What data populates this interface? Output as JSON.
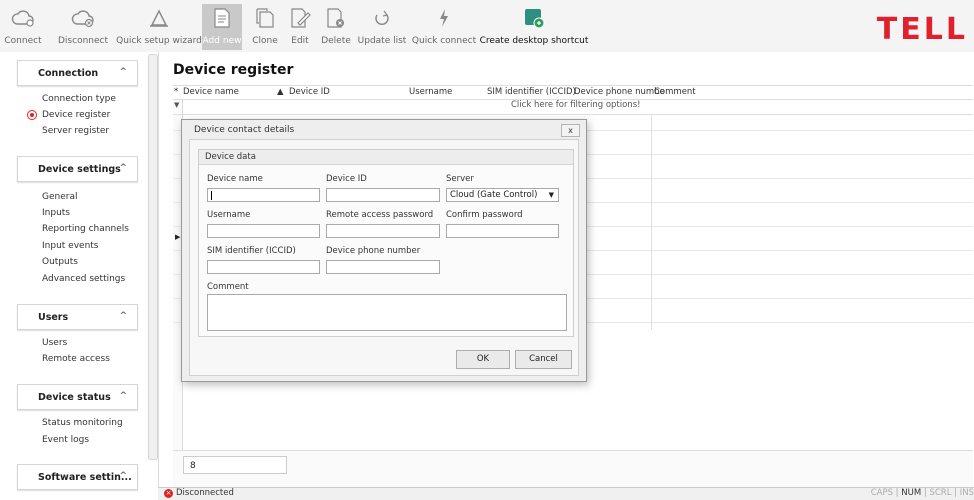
{
  "toolbar": {
    "connect": "Connect",
    "disconnect": "Disconnect",
    "quick_setup_wizard": "Quick setup wizard",
    "add_new": "Add new",
    "clone": "Clone",
    "edit": "Edit",
    "delete": "Delete",
    "update_list": "Update list",
    "quick_connect": "Quick connect",
    "create_desktop_shortcut": "Create desktop shortcut",
    "logo": "TELL"
  },
  "sidebar": {
    "connection": {
      "title": "Connection",
      "items": [
        "Connection type",
        "Device register",
        "Server register"
      ],
      "selected": "Device register"
    },
    "device_settings": {
      "title": "Device settings",
      "items": [
        "General",
        "Inputs",
        "Reporting channels",
        "Input events",
        "Outputs",
        "Advanced settings"
      ]
    },
    "users": {
      "title": "Users",
      "items": [
        "Users",
        "Remote access"
      ]
    },
    "device_status": {
      "title": "Device status",
      "items": [
        "Status monitoring",
        "Event logs"
      ]
    },
    "software_settings": {
      "title": "Software settin..."
    }
  },
  "main": {
    "title": "Device register",
    "columns": [
      "Device name",
      "Device ID",
      "Username",
      "SIM identifier (ICCID)",
      "Device phone numbe",
      "Comment"
    ],
    "filter_hint": "Click here for filtering options!",
    "footer_value": "8"
  },
  "dialog": {
    "title": "Device contact details",
    "close": "x",
    "group_title": "Device data",
    "labels": {
      "device_name": "Device name",
      "device_id": "Device ID",
      "server": "Server",
      "username": "Username",
      "remote_password": "Remote access password",
      "confirm_password": "Confirm password",
      "sim": "SIM identifier (ICCID)",
      "phone": "Device phone number",
      "comment": "Comment"
    },
    "server_value": "Cloud (Gate Control)",
    "ok": "OK",
    "cancel": "Cancel"
  },
  "status": {
    "text": "Disconnected",
    "caps": "CAPS",
    "num": "NUM",
    "scrl": "SCRL",
    "ins": "INS"
  }
}
